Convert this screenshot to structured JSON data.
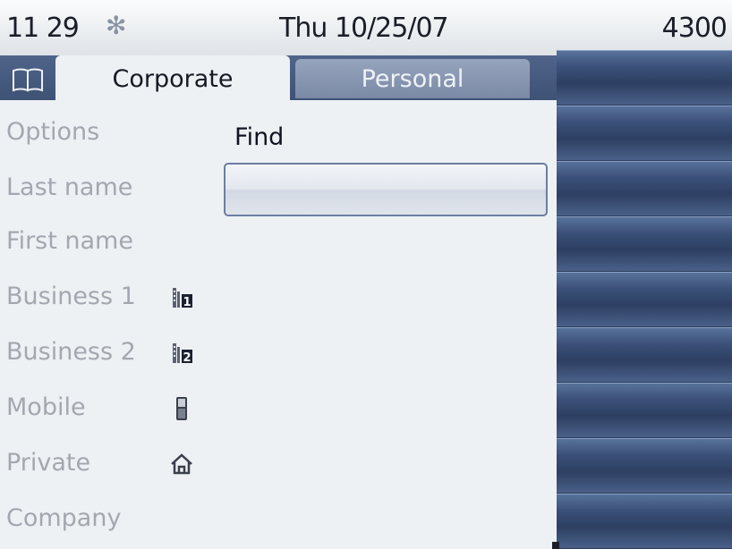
{
  "status": {
    "time": "11 29",
    "bluetooth_icon": "bluetooth-icon",
    "date": "Thu 10/25/07",
    "extension": "4300"
  },
  "tabs": [
    {
      "label": "Corporate",
      "active": true
    },
    {
      "label": "Personal",
      "active": false
    }
  ],
  "book_icon": "book-icon",
  "form": {
    "rows": [
      {
        "label": "Options",
        "icon": ""
      },
      {
        "label": "Last name",
        "icon": ""
      },
      {
        "label": "First name",
        "icon": ""
      },
      {
        "label": "Business 1",
        "icon": "business-1-icon"
      },
      {
        "label": "Business 2",
        "icon": "business-2-icon"
      },
      {
        "label": "Mobile",
        "icon": "mobile-phone-icon"
      },
      {
        "label": "Private",
        "icon": "home-icon"
      },
      {
        "label": "Company",
        "icon": ""
      }
    ],
    "find_label": "Find",
    "find_value": ""
  },
  "softkeys_count": 9,
  "colors": {
    "accent_dark": "#2d3d5f",
    "tab_bar": "#3e5275",
    "label_gray": "#a3a8b0"
  }
}
